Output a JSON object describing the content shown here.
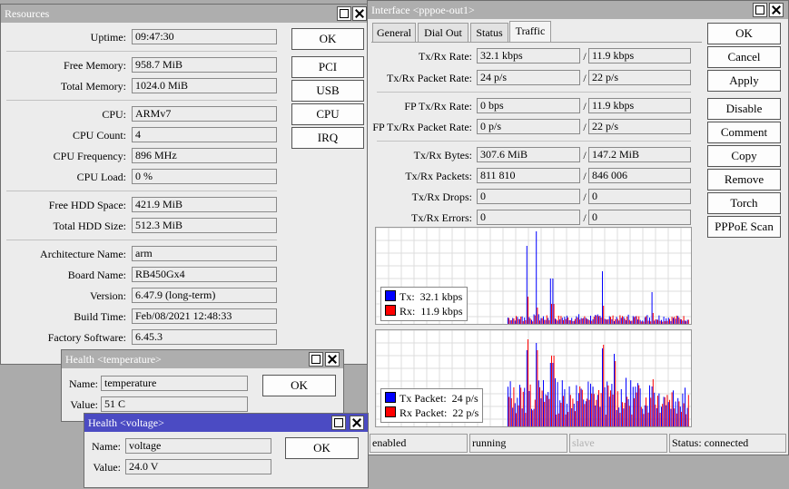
{
  "resources": {
    "title": "Resources",
    "rows": [
      {
        "label": "Uptime:",
        "value": "09:47:30"
      },
      {
        "label": "Free Memory:",
        "value": "958.7 MiB"
      },
      {
        "label": "Total Memory:",
        "value": "1024.0 MiB"
      },
      {
        "label": "CPU:",
        "value": "ARMv7"
      },
      {
        "label": "CPU Count:",
        "value": "4"
      },
      {
        "label": "CPU Frequency:",
        "value": "896 MHz"
      },
      {
        "label": "CPU Load:",
        "value": "0 %"
      },
      {
        "label": "Free HDD Space:",
        "value": "421.9 MiB"
      },
      {
        "label": "Total HDD Size:",
        "value": "512.3 MiB"
      },
      {
        "label": "Architecture Name:",
        "value": "arm"
      },
      {
        "label": "Board Name:",
        "value": "RB450Gx4"
      },
      {
        "label": "Version:",
        "value": "6.47.9 (long-term)"
      },
      {
        "label": "Build Time:",
        "value": "Feb/08/2021 12:48:33"
      },
      {
        "label": "Factory Software:",
        "value": "6.45.3"
      }
    ],
    "buttons": {
      "ok": "OK",
      "pci": "PCI",
      "usb": "USB",
      "cpu": "CPU",
      "irq": "IRQ"
    }
  },
  "interface": {
    "title": "Interface <pppoe-out1>",
    "tabs": [
      "General",
      "Dial Out",
      "Status",
      "Traffic"
    ],
    "active_tab": "Traffic",
    "rows": [
      {
        "label": "Tx/Rx Rate:",
        "tx": "32.1 kbps",
        "rx": "11.9 kbps"
      },
      {
        "label": "Tx/Rx Packet Rate:",
        "tx": "24 p/s",
        "rx": "22 p/s"
      },
      {
        "label": "FP Tx/Rx Rate:",
        "tx": "0 bps",
        "rx": "11.9 kbps"
      },
      {
        "label": "FP Tx/Rx Packet Rate:",
        "tx": "0 p/s",
        "rx": "22 p/s"
      },
      {
        "label": "Tx/Rx Bytes:",
        "tx": "307.6 MiB",
        "rx": "147.2 MiB"
      },
      {
        "label": "Tx/Rx Packets:",
        "tx": "811 810",
        "rx": "846 006"
      },
      {
        "label": "Tx/Rx Drops:",
        "tx": "0",
        "rx": "0"
      },
      {
        "label": "Tx/Rx Errors:",
        "tx": "0",
        "rx": "0"
      }
    ],
    "separator": "/",
    "buttons": {
      "ok": "OK",
      "cancel": "Cancel",
      "apply": "Apply",
      "disable": "Disable",
      "comment": "Comment",
      "copy": "Copy",
      "remove": "Remove",
      "torch": "Torch",
      "pppoe_scan": "PPPoE Scan"
    },
    "graph_rate": {
      "legend": [
        {
          "label": "Tx:",
          "value": "32.1 kbps",
          "color": "#0000ff"
        },
        {
          "label": "Rx:",
          "value": "11.9 kbps",
          "color": "#ff0000"
        }
      ]
    },
    "graph_packet": {
      "legend": [
        {
          "label": "Tx Packet:",
          "value": "24 p/s",
          "color": "#0000ff"
        },
        {
          "label": "Rx Packet:",
          "value": "22 p/s",
          "color": "#ff0000"
        }
      ]
    },
    "status_bar": [
      "enabled",
      "running",
      "slave",
      "Status: connected"
    ]
  },
  "health_temp": {
    "title": "Health <temperature>",
    "name_label": "Name:",
    "name": "temperature",
    "value_label": "Value:",
    "value": "51 C",
    "ok": "OK"
  },
  "health_volt": {
    "title": "Health <voltage>",
    "name_label": "Name:",
    "name": "voltage",
    "value_label": "Value:",
    "value": "24.0 V",
    "ok": "OK"
  },
  "colors": {
    "tx": "#0000ff",
    "rx": "#ff0000",
    "active_title": "#4b4bc3",
    "inactive_title": "#aeaeae"
  }
}
